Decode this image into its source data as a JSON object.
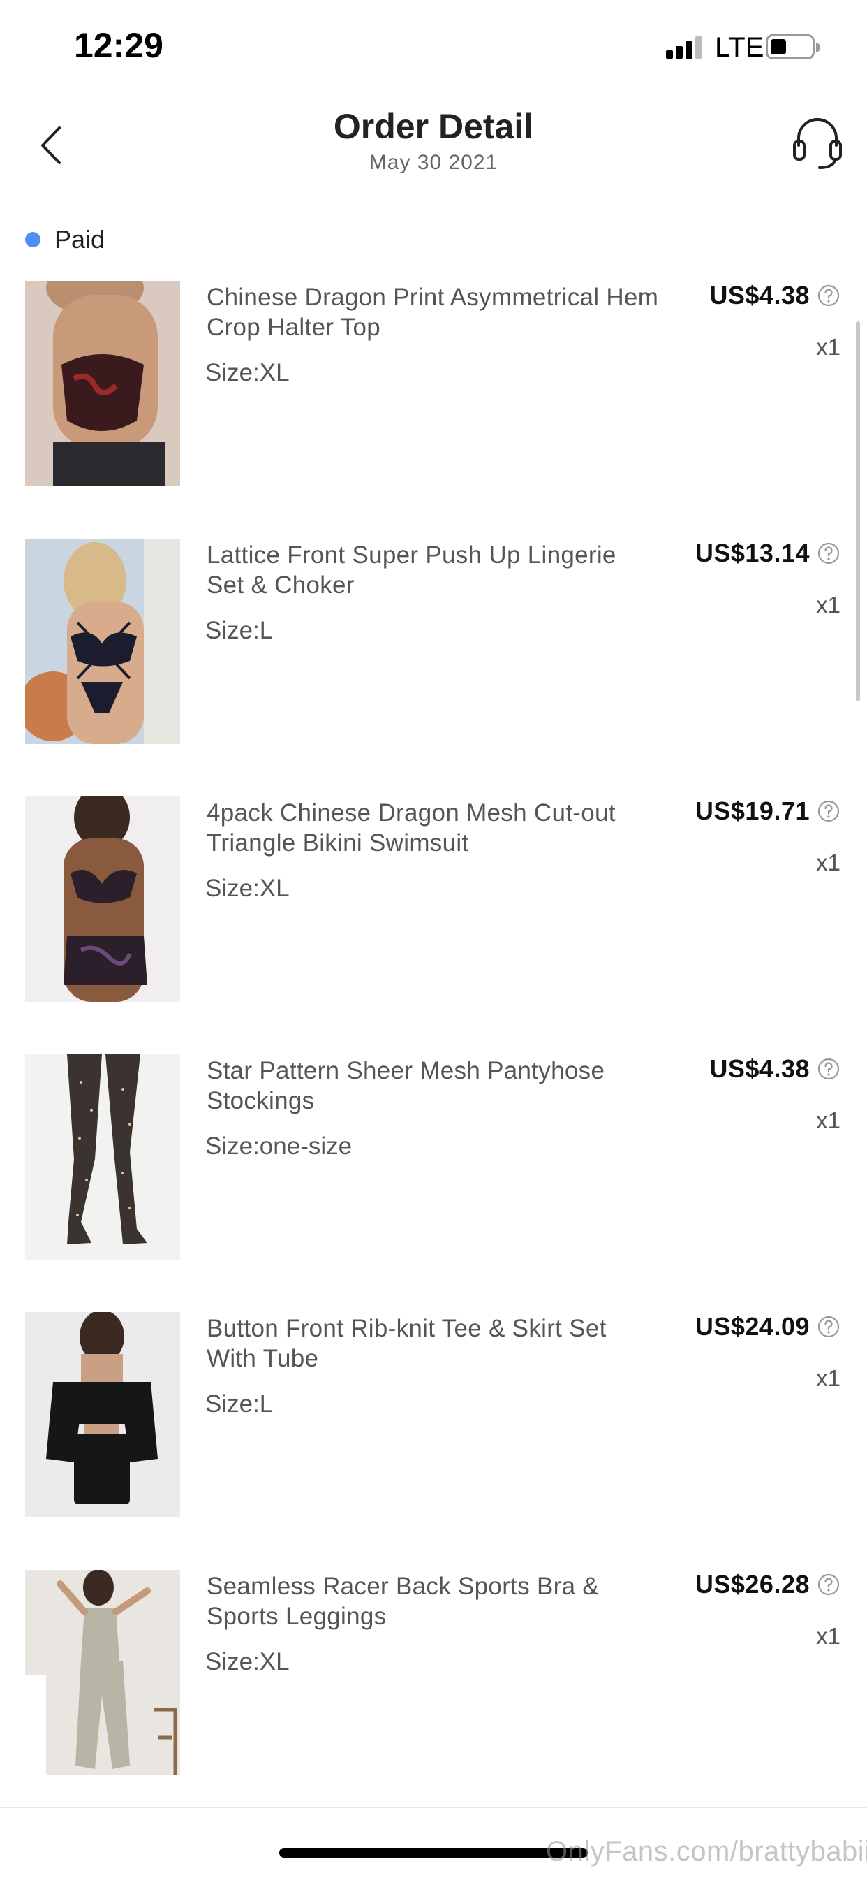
{
  "status_bar": {
    "time": "12:29",
    "network": "LTE",
    "signal_bars": 3,
    "battery_level": 0.3
  },
  "header": {
    "title": "Order Detail",
    "date": "May 30 2021",
    "back_icon": "chevron-left-icon",
    "support_icon": "headset-icon"
  },
  "order": {
    "status": "Paid",
    "status_color": "#4d8ff5"
  },
  "items": [
    {
      "name": "Chinese Dragon Print Asymmetrical Hem Crop Halter Top",
      "size": "Size:XL",
      "price": "US$4.38",
      "qty": "x1",
      "image_bg": "#d9c9bf",
      "image_main": "#3a1a1c"
    },
    {
      "name": "Lattice Front Super Push Up Lingerie Set & Choker",
      "size": "Size:L",
      "price": "US$13.14",
      "qty": "x1",
      "image_bg": "#c9d6e2",
      "image_main": "#1b1d2e"
    },
    {
      "name": "4pack Chinese Dragon Mesh Cut-out Triangle Bikini Swimsuit",
      "size": "Size:XL",
      "price": "US$19.71",
      "qty": "x1",
      "image_bg": "#f0eeee",
      "image_main": "#2a1f2a"
    },
    {
      "name": "Star Pattern Sheer Mesh Pantyhose Stockings",
      "size": "Size:one-size",
      "price": "US$4.38",
      "qty": "x1",
      "image_bg": "#f2f2f0",
      "image_main": "#3b3330"
    },
    {
      "name": "Button Front Rib-knit Tee & Skirt Set With Tube",
      "size": "Size:L",
      "price": "US$24.09",
      "qty": "x1",
      "image_bg": "#ecebeb",
      "image_main": "#161616"
    },
    {
      "name": "Seamless Racer Back Sports Bra & Sports Leggings",
      "size": "Size:XL",
      "price": "US$26.28",
      "qty": "x1",
      "image_bg": "#e9e5e0",
      "image_main": "#b9b5a6"
    }
  ],
  "watermark": "OnlyFans.com/brattybabiii"
}
